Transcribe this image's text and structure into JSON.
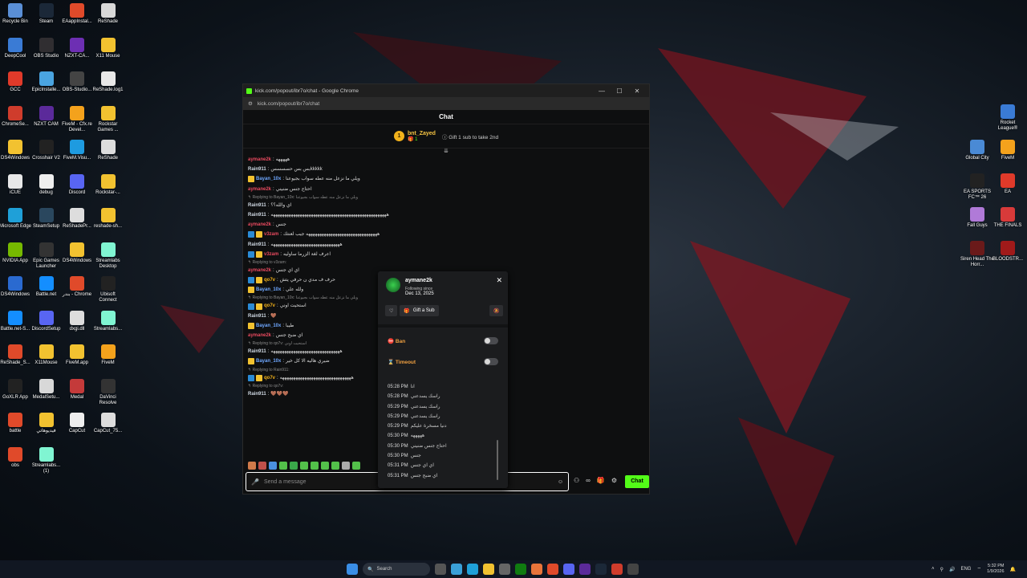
{
  "desktop": {
    "left_icons": [
      {
        "label": "Recycle Bin",
        "color": "#5a8fd6"
      },
      {
        "label": "Steam",
        "color": "#1b2838"
      },
      {
        "label": "EAappInstal...",
        "color": "#e04a2a"
      },
      {
        "label": "ReShade",
        "color": "#d8d8d8"
      },
      {
        "label": "DeepCool",
        "color": "#3a7bd5"
      },
      {
        "label": "OBS Studio",
        "color": "#302e31"
      },
      {
        "label": "NZXT-CA...",
        "color": "#6d2fb3"
      },
      {
        "label": "X11 Mouse",
        "color": "#f2c230"
      },
      {
        "label": "GCC",
        "color": "#e03a2a"
      },
      {
        "label": "EpicInstalle...",
        "color": "#4aa4e0"
      },
      {
        "label": "OBS-Studio...",
        "color": "#444"
      },
      {
        "label": "ReShade.log1",
        "color": "#e8e8e8"
      },
      {
        "label": "ChromeSe...",
        "color": "#cf3c2c"
      },
      {
        "label": "NZXT CAM",
        "color": "#5b2a9a"
      },
      {
        "label": "FiveM - Cfx.re Devel...",
        "color": "#f4a21c"
      },
      {
        "label": "Rockstar Games ...",
        "color": "#f2c230"
      },
      {
        "label": "DS4Windows",
        "color": "#f2c230"
      },
      {
        "label": "Crosshair V2",
        "color": "#222"
      },
      {
        "label": "FiveM.Visu...",
        "color": "#1e9be0"
      },
      {
        "label": "ReShade",
        "color": "#ddd"
      },
      {
        "label": "iCUE",
        "color": "#e8e8e8"
      },
      {
        "label": "debug",
        "color": "#eee"
      },
      {
        "label": "Discord",
        "color": "#5865f2"
      },
      {
        "label": "Rockstar-...",
        "color": "#f2c230"
      },
      {
        "label": "Microsoft Edge",
        "color": "#1fa0d8"
      },
      {
        "label": "SteamSetup",
        "color": "#2a475e"
      },
      {
        "label": "ReShadePr...",
        "color": "#ddd"
      },
      {
        "label": "reshade-sh...",
        "color": "#f2c230"
      },
      {
        "label": "NVIDIA App",
        "color": "#76b900"
      },
      {
        "label": "Epic Games Launcher",
        "color": "#333"
      },
      {
        "label": "DS4Windows",
        "color": "#f2c230"
      },
      {
        "label": "Streamlabs Desktop",
        "color": "#80f5d2"
      },
      {
        "label": "DS4Windows",
        "color": "#2a6ad0"
      },
      {
        "label": "Battle.net",
        "color": "#148eff"
      },
      {
        "label": "بندر - Chrome",
        "color": "#e04a2a"
      },
      {
        "label": "Ubisoft Connect",
        "color": "#222"
      },
      {
        "label": "Battle.net-S...",
        "color": "#148eff"
      },
      {
        "label": "DiscordSetup",
        "color": "#5865f2"
      },
      {
        "label": "dxgi.dll",
        "color": "#ddd"
      },
      {
        "label": "Streamlabs...",
        "color": "#80f5d2"
      },
      {
        "label": "ReShade_S...",
        "color": "#e04a2a"
      },
      {
        "label": "X11Mouse",
        "color": "#f2c230"
      },
      {
        "label": "FiveM.app",
        "color": "#f2c230"
      },
      {
        "label": "FiveM",
        "color": "#f4a21c"
      },
      {
        "label": "GoXLR App",
        "color": "#222"
      },
      {
        "label": "MedalSetu...",
        "color": "#d8d8d8"
      },
      {
        "label": "Medal",
        "color": "#c43a3a"
      },
      {
        "label": "DaVinci Resolve",
        "color": "#333"
      },
      {
        "label": "battle",
        "color": "#e04a2a"
      },
      {
        "label": "فيديوهاتي",
        "color": "#f2c230"
      },
      {
        "label": "CapCut",
        "color": "#eee"
      },
      {
        "label": "CapCut_75...",
        "color": "#ddd"
      },
      {
        "label": "obs",
        "color": "#e04a2a"
      },
      {
        "label": "Streamlabs... (1)",
        "color": "#80f5d2"
      }
    ],
    "right_icons": [
      {
        "label": "Rocket League®",
        "color": "#3a7bd5"
      },
      {
        "label": "Global City",
        "color": "#4a8ad5"
      },
      {
        "label": "FiveM",
        "color": "#f4a21c"
      },
      {
        "label": "EA SPORTS FC™ 26",
        "color": "#222"
      },
      {
        "label": "EA",
        "color": "#e03a2a"
      },
      {
        "label": "Fall Guys",
        "color": "#b07ad8"
      },
      {
        "label": "THE FINALS",
        "color": "#d83a3a"
      },
      {
        "label": "Siren Head The Horr...",
        "color": "#6a1a1a"
      },
      {
        "label": "BLOODSTR...",
        "color": "#a01a1a"
      }
    ]
  },
  "window": {
    "title": "kick.com/popout/ibr7o/chat - Google Chrome",
    "url": "kick.com/popout/ibr7o/chat",
    "minimize": "—",
    "maximize": "☐",
    "close": "✕"
  },
  "chat": {
    "header": "Chat",
    "pinned": {
      "rank": "1",
      "username": "bnt_Zayed",
      "subs": "1",
      "info": "Gift 1 sub to take 2nd"
    },
    "scroll_indicator": "⇊",
    "messages": [
      {
        "type": "msg",
        "badges": [],
        "user": "aymane2k",
        "user_color": "#e84a5f",
        "text": "هههههه"
      },
      {
        "type": "msg",
        "badges": [],
        "user": "Rain911",
        "user_color": "#cfd8e3",
        "text": "بس بس حسسسسkkkkk"
      },
      {
        "type": "msg",
        "badges": [
          "#f2c230"
        ],
        "user": "Bayan_10x",
        "user_color": "#6fa8ff",
        "text": "ويلي ما نزعل منه عطه سواب بجيوعنا"
      },
      {
        "type": "msg",
        "badges": [],
        "user": "aymane2k",
        "user_color": "#e84a5f",
        "text": "احتاج جنس ضنيني"
      },
      {
        "type": "reply",
        "text": "↰ Replying to Bayan_10x: ويلي ما نزعل منه عطه سواب بجيوعنا"
      },
      {
        "type": "msg",
        "badges": [],
        "user": "Rain911",
        "user_color": "#cfd8e3",
        "text": "اي والله؟؟"
      },
      {
        "type": "msg",
        "badges": [],
        "user": "Rain911",
        "user_color": "#cfd8e3",
        "text": "ههههههههههههههههههههههههههههههههههههههههههههههههههههه"
      },
      {
        "type": "msg",
        "badges": [],
        "user": "aymane2k",
        "user_color": "#e84a5f",
        "text": "جنس"
      },
      {
        "type": "msg",
        "badges": [
          "#2a8ad5",
          "#f2c230"
        ],
        "user": "v3zam",
        "user_color": "#e84a5f",
        "text": "ههههههههههههههههههههههههههههههههه جيب لعنتك"
      },
      {
        "type": "msg",
        "badges": [],
        "user": "Rain911",
        "user_color": "#cfd8e3",
        "text": "هههههههههههههههههههههههههههههههه"
      },
      {
        "type": "msg",
        "badges": [
          "#2a8ad5",
          "#f2c230"
        ],
        "user": "v3zam",
        "user_color": "#e84a5f",
        "text": "اعرف لغة الزرما ساوليه"
      },
      {
        "type": "reply",
        "text": "↰ Replying to v3zam:"
      },
      {
        "type": "msg",
        "badges": [],
        "user": "aymane2k",
        "user_color": "#e84a5f",
        "text": "اي اي جنس"
      },
      {
        "type": "msg",
        "badges": [
          "#2a8ad5",
          "#f2c230"
        ],
        "user": "qo7v",
        "user_color": "#f2b21b",
        "text": "حرف ف مدي ن حرفي يتش"
      },
      {
        "type": "msg",
        "badges": [
          "#f2c230"
        ],
        "user": "Bayan_10x",
        "user_color": "#6fa8ff",
        "text": "ولله علي"
      },
      {
        "type": "reply",
        "text": "↰ Replying to Bayan_10x: ويلي ما نزعل منه عطه سواب بجيوعنا"
      },
      {
        "type": "msg",
        "badges": [
          "#2a8ad5",
          "#f2c230"
        ],
        "user": "qo7v",
        "user_color": "#f2b21b",
        "text": "استحيت اوني"
      },
      {
        "type": "msg",
        "badges": [],
        "user": "Rain911",
        "user_color": "#cfd8e3",
        "text": "🤎"
      },
      {
        "type": "msg",
        "badges": [
          "#f2c230"
        ],
        "user": "Bayan_10x",
        "user_color": "#6fa8ff",
        "text": "طيبا"
      },
      {
        "type": "msg",
        "badges": [],
        "user": "aymane2k",
        "user_color": "#e84a5f",
        "text": "اي ضبح جنس"
      },
      {
        "type": "reply",
        "text": "↰ Replying to qo7v: استحيت اوني"
      },
      {
        "type": "msg",
        "badges": [],
        "user": "Rain911",
        "user_color": "#cfd8e3",
        "text": "هههههههههههههههههههههههههههههههه"
      },
      {
        "type": "msg",
        "badges": [
          "#f2c230"
        ],
        "user": "Bayan_10x",
        "user_color": "#6fa8ff",
        "text": "ضيري هاليه الا كل خير"
      },
      {
        "type": "reply",
        "text": "↰ Replying to Rain911:"
      },
      {
        "type": "msg",
        "badges": [
          "#2a8ad5",
          "#f2c230"
        ],
        "user": "qo7v",
        "user_color": "#f2b21b",
        "text": "ههههههههههههههههههههههههههههههههه"
      },
      {
        "type": "reply",
        "text": "↰ Replying to qo7v:"
      },
      {
        "type": "msg",
        "badges": [],
        "user": "Rain911",
        "user_color": "#cfd8e3",
        "text": "🤎🤎🤎"
      }
    ],
    "emotes": [
      "#d07a4a",
      "#c0504a",
      "#4a90e0",
      "#53c04a",
      "#3aa84a",
      "#53c04a",
      "#53c04a",
      "#53c04a",
      "#53c04a",
      "#aaa",
      "#53c04a"
    ],
    "input_placeholder": "Send a message",
    "send_label": "Chat",
    "accent": "#53fc18"
  },
  "user_card": {
    "username": "aymane2k",
    "following_label": "Following since",
    "following_date": "Dec 13, 2025",
    "close": "✕",
    "gift_label": "Gift a Sub",
    "ban_label": "Ban",
    "timeout_label": "Timeout",
    "history": [
      {
        "time": "05:28 PM",
        "text": "انا"
      },
      {
        "time": "05:28 PM",
        "text": "راسك يسدعني"
      },
      {
        "time": "05:29 PM",
        "text": "راسك يسدعني"
      },
      {
        "time": "05:29 PM",
        "text": "راسك يسدعني"
      },
      {
        "time": "05:29 PM",
        "text": "دنيا مسخرة عليكم"
      },
      {
        "time": "05:30 PM",
        "text": "هههههه"
      },
      {
        "time": "05:30 PM",
        "text": "احتاج جنس ضنيني"
      },
      {
        "time": "05:30 PM",
        "text": "جنس"
      },
      {
        "time": "05:31 PM",
        "text": "اي اي جنس"
      },
      {
        "time": "05:31 PM",
        "text": "اي ضبح جنس"
      }
    ]
  },
  "taskbar": {
    "search_label": "Search",
    "lang": "ENG",
    "time": "5:32 PM",
    "date": "1/9/2026"
  }
}
